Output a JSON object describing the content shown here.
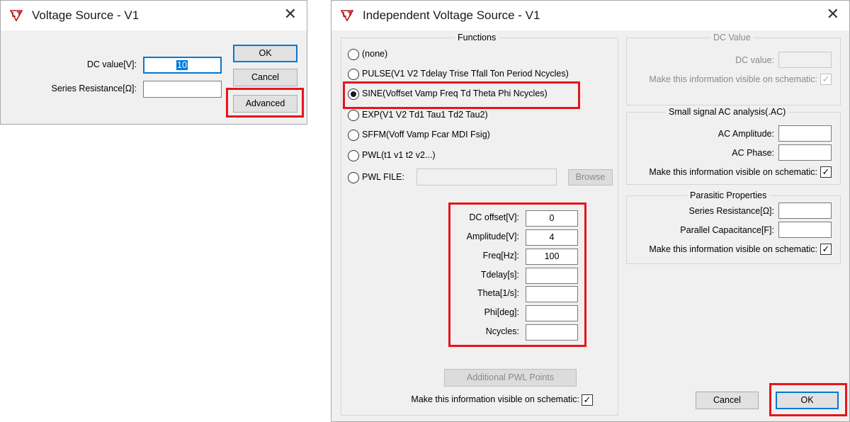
{
  "dialog1": {
    "title": "Voltage Source - V1",
    "dc_value_label": "DC value[V]:",
    "dc_value": "10",
    "series_resistance_label": "Series Resistance[Ω]:",
    "series_resistance_value": "",
    "ok_label": "OK",
    "cancel_label": "Cancel",
    "advanced_label": "Advanced"
  },
  "dialog2": {
    "title": "Independent Voltage Source - V1",
    "functions": {
      "title": "Functions",
      "options": [
        "(none)",
        "PULSE(V1 V2 Tdelay Trise Tfall Ton Period Ncycles)",
        "SINE(Voffset Vamp Freq Td Theta Phi Ncycles)",
        "EXP(V1 V2 Td1 Tau1 Td2 Tau2)",
        "SFFM(Voff Vamp Fcar MDI Fsig)",
        "PWL(t1 v1 t2 v2...)",
        "PWL FILE:"
      ],
      "selected": "SINE(Voffset Vamp Freq Td Theta Phi Ncycles)",
      "browse_label": "Browse",
      "pwl_file_value": "",
      "params": [
        {
          "label": "DC offset[V]:",
          "value": "0"
        },
        {
          "label": "Amplitude[V]:",
          "value": "4"
        },
        {
          "label": "Freq[Hz]:",
          "value": "100"
        },
        {
          "label": "Tdelay[s]:",
          "value": ""
        },
        {
          "label": "Theta[1/s]:",
          "value": ""
        },
        {
          "label": "Phi[deg]:",
          "value": ""
        },
        {
          "label": "Ncycles:",
          "value": ""
        }
      ],
      "additional_pwl_label": "Additional PWL Points",
      "visible_label": "Make this information visible on schematic:"
    },
    "dc_value": {
      "title": "DC Value",
      "label": "DC value:",
      "value": "",
      "visible_label": "Make this information visible on schematic:"
    },
    "ac": {
      "title": "Small signal AC analysis(.AC)",
      "amp_label": "AC Amplitude:",
      "amp_value": "",
      "phase_label": "AC Phase:",
      "phase_value": "",
      "visible_label": "Make this information visible on schematic:"
    },
    "parasitic": {
      "title": "Parasitic Properties",
      "rs_label": "Series Resistance[Ω]:",
      "rs_value": "",
      "cp_label": "Parallel Capacitance[F]:",
      "cp_value": "",
      "visible_label": "Make this information visible on schematic:"
    },
    "cancel_label": "Cancel",
    "ok_label": "OK"
  },
  "colors": {
    "highlight": "#e8141c",
    "focus": "#0078d7"
  },
  "icons": [
    "lt-app-icon",
    "close-icon",
    "radio-icon",
    "checkbox-icon"
  ]
}
